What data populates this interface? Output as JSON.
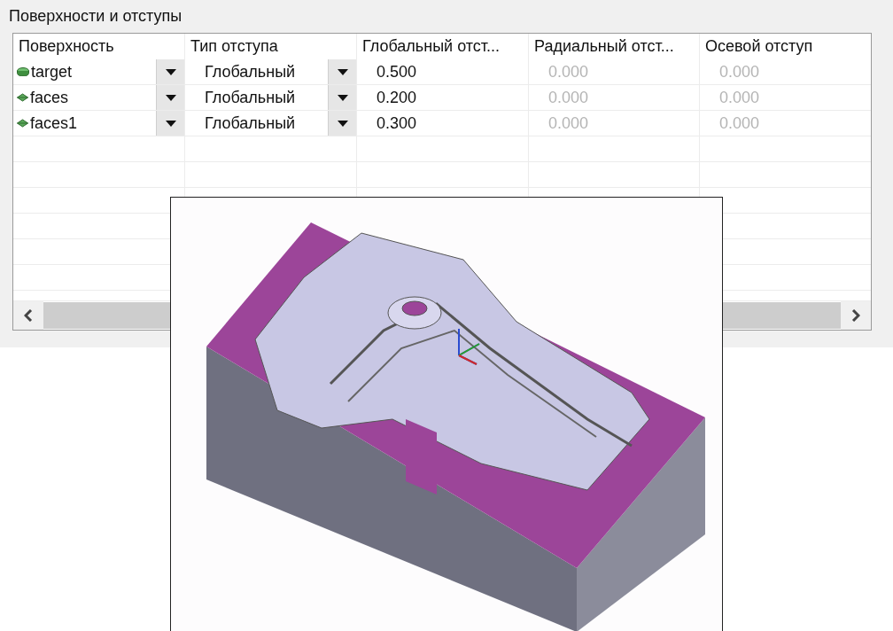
{
  "group": {
    "title": "Поверхности и отступы"
  },
  "table": {
    "columns": [
      "Поверхность",
      "Тип отступа",
      "Глобальный отст...",
      "Радиальный отст...",
      "Осевой отступ"
    ],
    "rows": [
      {
        "surface": "target",
        "kind": "body",
        "type": "Глобальный",
        "global": "0.500",
        "radial": "0.000",
        "axial": "0.000",
        "disabled": true
      },
      {
        "surface": "faces",
        "kind": "faces",
        "type": "Глобальный",
        "global": "0.200",
        "radial": "0.000",
        "axial": "0.000",
        "disabled": true
      },
      {
        "surface": "faces1",
        "kind": "faces",
        "type": "Глобальный",
        "global": "0.300",
        "radial": "0.000",
        "axial": "0.000",
        "disabled": true
      }
    ]
  }
}
